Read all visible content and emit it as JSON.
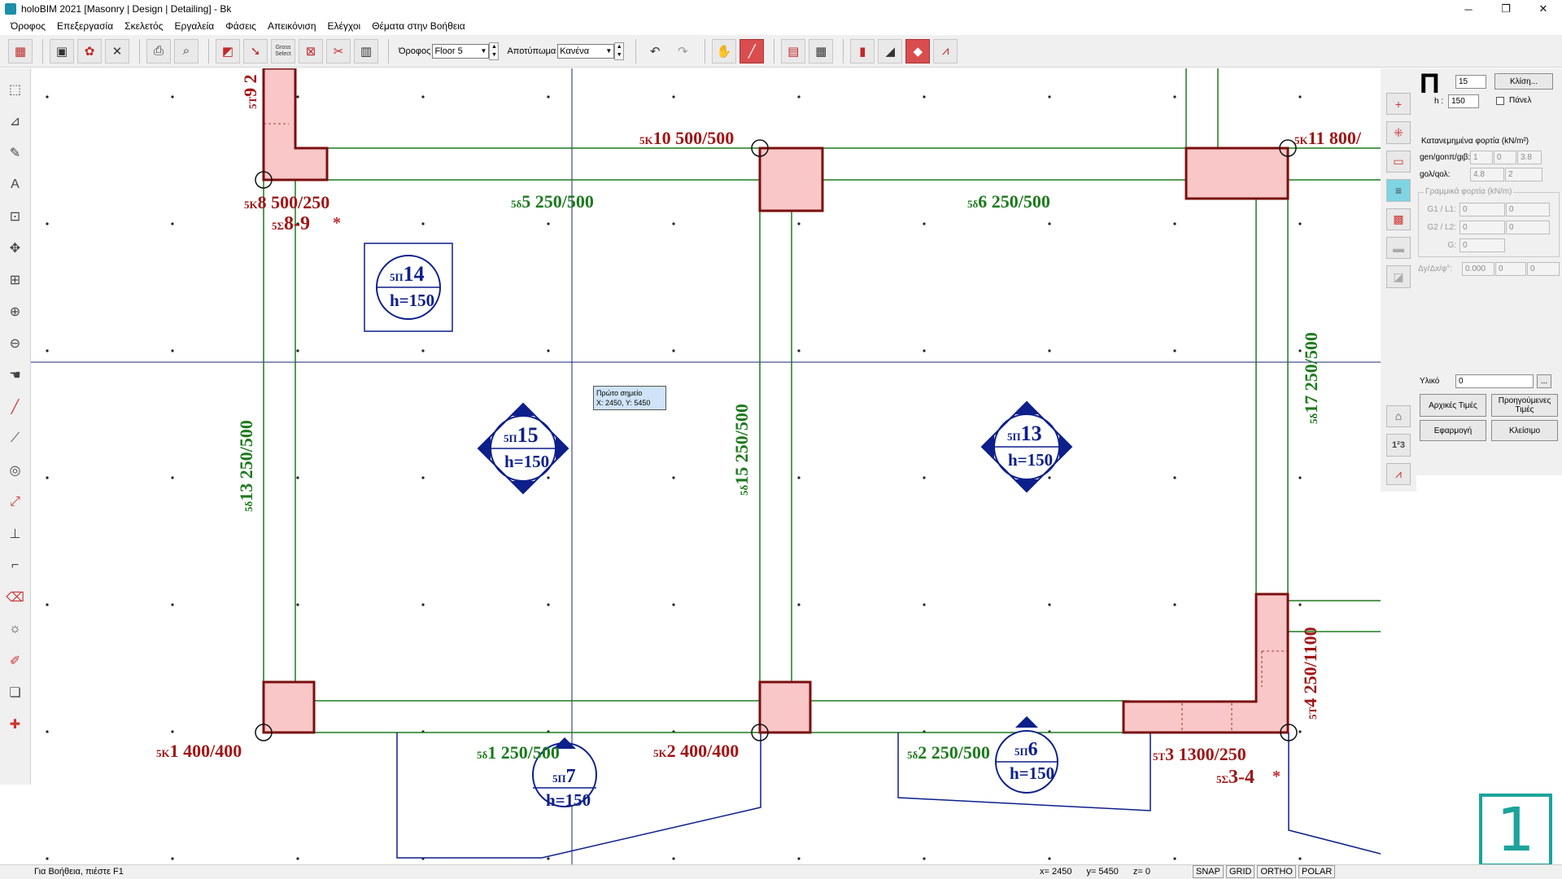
{
  "window": {
    "title": "holoBIM 2021 [Masonry | Design | Detailing] - Bk",
    "minimize_glyph": "─",
    "maximize_glyph": "❐",
    "close_glyph": "✕"
  },
  "menu": [
    {
      "id": "floor",
      "label": "Όροφος"
    },
    {
      "id": "edit",
      "label": "Επεξεργασία"
    },
    {
      "id": "skeleton",
      "label": "Σκελετός"
    },
    {
      "id": "tools",
      "label": "Εργαλεία"
    },
    {
      "id": "phases",
      "label": "Φάσεις"
    },
    {
      "id": "view",
      "label": "Απεικόνιση"
    },
    {
      "id": "checks",
      "label": "Ελέγχοι"
    },
    {
      "id": "help",
      "label": "Θέματα στην Βοήθεια"
    }
  ],
  "toolbar": {
    "gross_select_label": "Gross Select",
    "floor_label": "Όροφος",
    "floor_value": "Floor 5",
    "footprint_label": "Αποτύπωμα",
    "footprint_value": "Κανένα"
  },
  "tooltip": {
    "line1": "Πρώτο σημείο",
    "line2": "X: 2450, Y: 5450"
  },
  "drawing": {
    "columns": [
      {
        "prefix": "5K",
        "num": "1",
        "dims": "400/400"
      },
      {
        "prefix": "5K",
        "num": "2",
        "dims": "400/400"
      },
      {
        "prefix": "5T",
        "num": "3",
        "dims": "1300/250"
      },
      {
        "prefix": "5T",
        "num": "4",
        "dims": "250/1100"
      },
      {
        "prefix": "5K",
        "num": "8",
        "dims": "500/250"
      },
      {
        "prefix": "5T",
        "num": "9",
        "dims": "2"
      },
      {
        "prefix": "5K",
        "num": "10",
        "dims": "500/500"
      },
      {
        "prefix": "5K",
        "num": "11",
        "dims": "800/"
      }
    ],
    "beams": [
      {
        "prefix": "5δ",
        "num": "1",
        "dims": "250/500"
      },
      {
        "prefix": "5δ",
        "num": "2",
        "dims": "250/500"
      },
      {
        "prefix": "5δ",
        "num": "5",
        "dims": "250/500"
      },
      {
        "prefix": "5δ",
        "num": "6",
        "dims": "250/500"
      },
      {
        "prefix": "5δ",
        "num": "13",
        "dims": "250/500"
      },
      {
        "prefix": "5δ",
        "num": "15",
        "dims": "250/500"
      },
      {
        "prefix": "5δ",
        "num": "17",
        "dims": "250/500"
      }
    ],
    "walls": [
      {
        "prefix": "5Σ",
        "num": "8-9",
        "mark": "*"
      },
      {
        "prefix": "5Σ",
        "num": "3-4",
        "mark": "*"
      }
    ],
    "slabs": [
      {
        "prefix": "5Π",
        "num": "14",
        "h": "h=150"
      },
      {
        "prefix": "5Π",
        "num": "15",
        "h": "h=150"
      },
      {
        "prefix": "5Π",
        "num": "13",
        "h": "h=150"
      },
      {
        "prefix": "5Π",
        "num": "7",
        "h": "h=150"
      },
      {
        "prefix": "5Π",
        "num": "6",
        "h": "h=150"
      }
    ]
  },
  "panel": {
    "symbol": "Π",
    "value_top": "15",
    "h_label": "h :",
    "h_value": "150",
    "slope_button": "Κλίση...",
    "panel_checkbox": "Πάνελ",
    "distributed_title": "Κατανεμημένα φορτία (kN/m²)",
    "row1_label": "gen/gonπ/gιβ:",
    "row1_values": [
      "1",
      "0",
      "3.8"
    ],
    "row2_label": "gολ/qολ:",
    "row2_values": [
      "4.8",
      "2"
    ],
    "linear_title": "Γραμμικά φορτία (kN/m)",
    "g1_label": "G1 / L1:",
    "g1_values": [
      "0",
      "0"
    ],
    "g2_label": "G2 / L2:",
    "g2_values": [
      "0",
      "0"
    ],
    "g_label": "G:",
    "g_value": "0",
    "dy_label": "Δy/Δx/φ°:",
    "dy_values": [
      "0.000",
      "0",
      "0"
    ],
    "material_label": "Υλικό",
    "material_value": "0",
    "material_more": "...",
    "btn_initial": "Αρχικές Τιμές",
    "btn_previous": "Προηγούμενες Τιμές",
    "btn_apply": "Εφαρμογή",
    "btn_close": "Κλείσιμο"
  },
  "righttb": {
    "numbering_label": "1²3"
  },
  "status": {
    "help_text": "Για Βοήθεια, πιέστε F1",
    "x": "x= 2450",
    "y": "y= 5450",
    "z": "z= 0",
    "flags": [
      "SNAP",
      "GRID",
      "ORTHO",
      "POLAR"
    ]
  },
  "floor_number": "1",
  "colors": {
    "column_red": "#a01616",
    "beam_green": "#1d7a1d",
    "slab_blue": "#0c1f8a",
    "column_fill": "#f9c7c7",
    "badge_teal": "#1ba39c"
  }
}
